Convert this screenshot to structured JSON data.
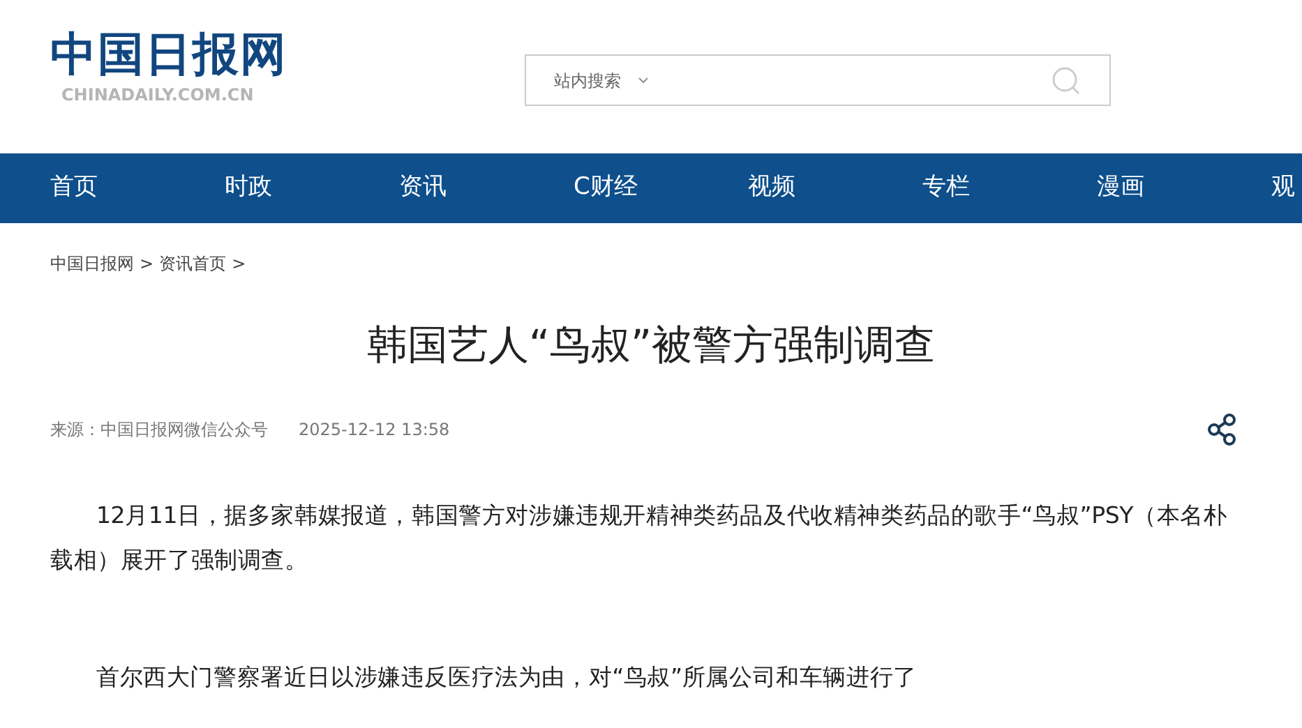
{
  "logo": {
    "name": "中国日报网",
    "domain": "CHINADAILY.COM.CN"
  },
  "search": {
    "scope": "站内搜索"
  },
  "nav": [
    {
      "label": "首页"
    },
    {
      "label": "时政"
    },
    {
      "label": "资讯"
    },
    {
      "label": "C财经"
    },
    {
      "label": "视频"
    },
    {
      "label": "专栏"
    },
    {
      "label": "漫画"
    },
    {
      "label": "观"
    }
  ],
  "breadcrumb": [
    {
      "label": "中国日报网",
      "separator": ">"
    },
    {
      "label": "资讯首页",
      "separator": ">"
    }
  ],
  "article": {
    "title": "韩国艺人“鸟叔”被警方强制调查",
    "source": "来源：中国日报网微信公众号",
    "time": "2025-12-12 13:58",
    "paragraphs": [
      "12月11日，据多家韩媒报道，韩国警方对涉嫌违规开精神类药品及代收精神类药品的歌手“鸟叔”PSY（本名朴载相）展开了强制调查。",
      "首尔西大门警察署近日以涉嫌违反医疗法为由，对“鸟叔”所属公司和车辆进行了"
    ]
  }
}
